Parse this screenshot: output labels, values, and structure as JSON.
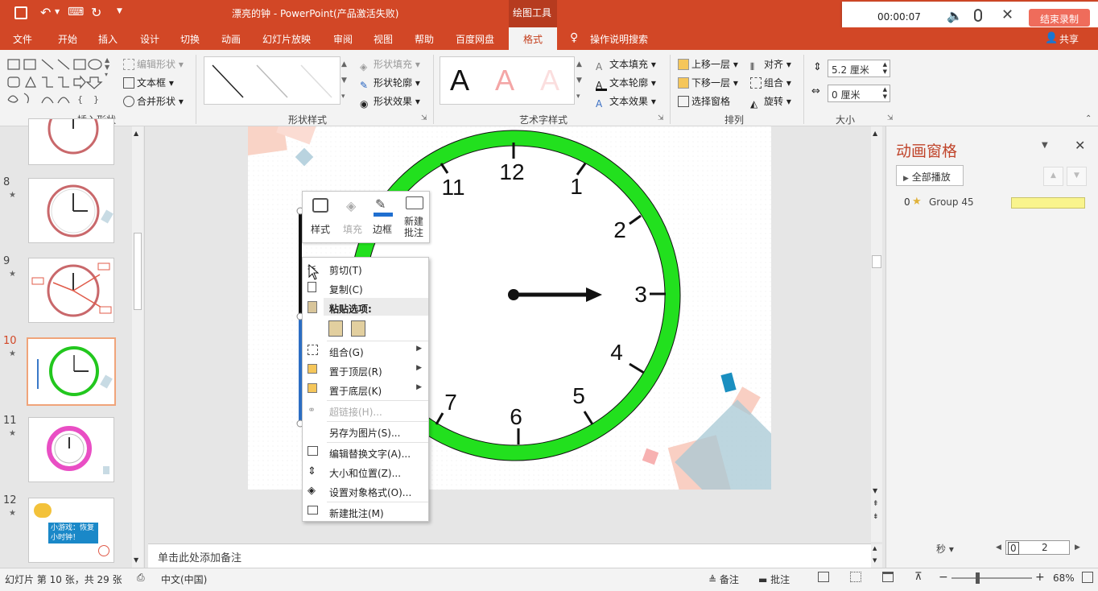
{
  "titlebar": {
    "title": "漂亮的钟  -  PowerPoint(产品激活失败)",
    "context_tab": "绘图工具"
  },
  "recorder": {
    "time": "00:00:07",
    "end_label": "结束录制"
  },
  "tabs": [
    "文件",
    "开始",
    "插入",
    "设计",
    "切换",
    "动画",
    "幻灯片放映",
    "审阅",
    "视图",
    "帮助",
    "百度网盘",
    "格式"
  ],
  "tell_me": "操作说明搜索",
  "share": "共享",
  "ribbon": {
    "insert_shapes": {
      "label": "插入形状",
      "edit_shape": "编辑形状",
      "text_box": "文本框",
      "merge_shapes": "合并形状"
    },
    "shape_styles": {
      "label": "形状样式",
      "fill": "形状填充",
      "outline": "形状轮廓",
      "effects": "形状效果"
    },
    "wordart": {
      "label": "艺术字样式",
      "sample": "A",
      "text_fill": "文本填充",
      "text_outline": "文本轮廓",
      "text_effects": "文本效果"
    },
    "arrange": {
      "label": "排列",
      "bring_forward": "上移一层",
      "send_backward": "下移一层",
      "selection_pane": "选择窗格",
      "align": "对齐",
      "group": "组合",
      "rotate": "旋转"
    },
    "size": {
      "label": "大小",
      "height": "5.2 厘米",
      "width": "0 厘米"
    }
  },
  "thumbnails": [
    {
      "num": "8",
      "star": "★"
    },
    {
      "num": "9",
      "star": "★"
    },
    {
      "num": "10",
      "star": "★"
    },
    {
      "num": "11",
      "star": "★"
    },
    {
      "num": "12",
      "star": "★",
      "caption": "小游戏：恢复小时钟！"
    }
  ],
  "clock": {
    "numbers": [
      "12",
      "1",
      "2",
      "3",
      "4",
      "5",
      "6",
      "7",
      "11"
    ],
    "rim_color": "#22e01e"
  },
  "mini_toolbar": {
    "style": "样式",
    "fill": "填充",
    "border": "边框",
    "new_comment": "新建批注"
  },
  "context_menu": {
    "cut": "剪切(T)",
    "copy": "复制(C)",
    "paste_options": "粘贴选项:",
    "group": "组合(G)",
    "bring_to_front": "置于顶层(R)",
    "send_to_back": "置于底层(K)",
    "hyperlink": "超链接(H)...",
    "save_as_picture": "另存为图片(S)...",
    "edit_alt_text": "编辑替换文字(A)...",
    "size_position": "大小和位置(Z)...",
    "format_object": "设置对象格式(O)...",
    "new_comment": "新建批注(M)"
  },
  "notes_placeholder": "单击此处添加备注",
  "animation_pane": {
    "title": "动画窗格",
    "play_all": "全部播放",
    "item_index": "0",
    "item_star": "★",
    "item_name": "Group 45",
    "seconds": "秒",
    "timeline_start": "0",
    "timeline_end": "2"
  },
  "status": {
    "slide_info": "幻灯片 第 10 张，共 29 张",
    "language": "中文(中国)",
    "notes": "备注",
    "comments": "批注",
    "zoom": "68%"
  }
}
